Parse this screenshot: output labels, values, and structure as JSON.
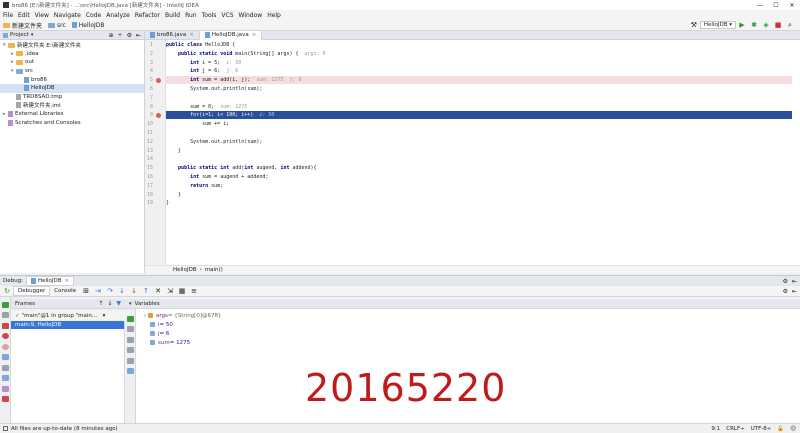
{
  "window": {
    "title": "bro86 [E:\\新建文件夹] - ...\\src\\HelloJDB.java [新建文件夹] - IntelliJ IDEA",
    "controls": [
      "—",
      "☐",
      "✕"
    ]
  },
  "menu": [
    "File",
    "Edit",
    "View",
    "Navigate",
    "Code",
    "Analyze",
    "Refactor",
    "Build",
    "Run",
    "Tools",
    "VCS",
    "Window",
    "Help"
  ],
  "breadcrumbs": [
    "新建文件夹",
    "src",
    "HelloJDB"
  ],
  "run_config": "HelloJDB",
  "project_panel": {
    "title": "Project",
    "tree": [
      {
        "label": "新建文件夹 E:\\新建文件夹",
        "indent": 0,
        "icon": "folder",
        "expanded": true
      },
      {
        "label": ".idea",
        "indent": 1,
        "icon": "folder",
        "expanded": false
      },
      {
        "label": "out",
        "indent": 1,
        "icon": "folder",
        "expanded": false
      },
      {
        "label": "src",
        "indent": 1,
        "icon": "folder-blue",
        "expanded": true
      },
      {
        "label": "bro86",
        "indent": 2,
        "icon": "class"
      },
      {
        "label": "HelloJDB",
        "indent": 2,
        "icon": "class",
        "selected": true
      },
      {
        "label": "TRD8SAD.tmp",
        "indent": 1,
        "icon": "txt"
      },
      {
        "label": "新建文件夹.iml",
        "indent": 1,
        "icon": "txt"
      },
      {
        "label": "External Libraries",
        "indent": 0,
        "icon": "lib",
        "expanded": false
      },
      {
        "label": "Scratches and Consoles",
        "indent": 0,
        "icon": "lib"
      }
    ]
  },
  "editor_tabs": [
    {
      "label": "bro86.java",
      "active": false
    },
    {
      "label": "HelloJDB.java",
      "active": true
    }
  ],
  "code_lines": [
    {
      "n": "1",
      "text": "public class HelloJDB {",
      "hint": ""
    },
    {
      "n": "2",
      "text": "    public static void main(String[] args) {",
      "hint": "args: 0"
    },
    {
      "n": "3",
      "text": "        int i = 5;",
      "hint": "i: 50"
    },
    {
      "n": "4",
      "text": "        int j = 6;",
      "hint": "j: 6"
    },
    {
      "n": "5",
      "text": "        int sum = add(i, j);",
      "hint": "sum: 1275  j: 6",
      "type": "bp"
    },
    {
      "n": "6",
      "text": "        System.out.println(sum);",
      "hint": ""
    },
    {
      "n": "7",
      "text": "",
      "hint": ""
    },
    {
      "n": "8",
      "text": "        sum = 0;",
      "hint": "sum: 1275"
    },
    {
      "n": "9",
      "text": "        for(i=1; i< 100; i++)",
      "hint": "i: 50",
      "type": "exec"
    },
    {
      "n": "10",
      "text": "            sum += i;",
      "hint": ""
    },
    {
      "n": "11",
      "text": "",
      "hint": ""
    },
    {
      "n": "12",
      "text": "        System.out.println(sum);",
      "hint": ""
    },
    {
      "n": "13",
      "text": "    }",
      "hint": ""
    },
    {
      "n": "14",
      "text": "",
      "hint": ""
    },
    {
      "n": "15",
      "text": "    public static int add(int augend, int addend){",
      "hint": ""
    },
    {
      "n": "16",
      "text": "        int sum = augend + addend;",
      "hint": ""
    },
    {
      "n": "17",
      "text": "        return sum;",
      "hint": ""
    },
    {
      "n": "18",
      "text": "    }",
      "hint": ""
    },
    {
      "n": "19",
      "text": "}",
      "hint": ""
    }
  ],
  "editor_breadcrumb": [
    "HelloJDB",
    "main()"
  ],
  "debug": {
    "label": "Debug:",
    "config": "HelloJDB",
    "tabs": [
      "Debugger",
      "Console"
    ],
    "frames_title": "Frames",
    "thread": "\"main\"@1 in group \"main\": RUNNING",
    "frames": [
      "main:9, HelloJDB"
    ],
    "variables_title": "Variables",
    "variables": [
      {
        "name": "args",
        "value": " = {String[0]@678}"
      },
      {
        "name": "i",
        "value": " = 50"
      },
      {
        "name": "j",
        "value": " = 6"
      },
      {
        "name": "sum",
        "value": " = 1275"
      }
    ]
  },
  "watermark": "20165220",
  "status": {
    "message": "All files are up-to-date (8 minutes ago)",
    "position": "9:1",
    "line_sep": "CRLF÷",
    "encoding": "UTF-8÷"
  }
}
